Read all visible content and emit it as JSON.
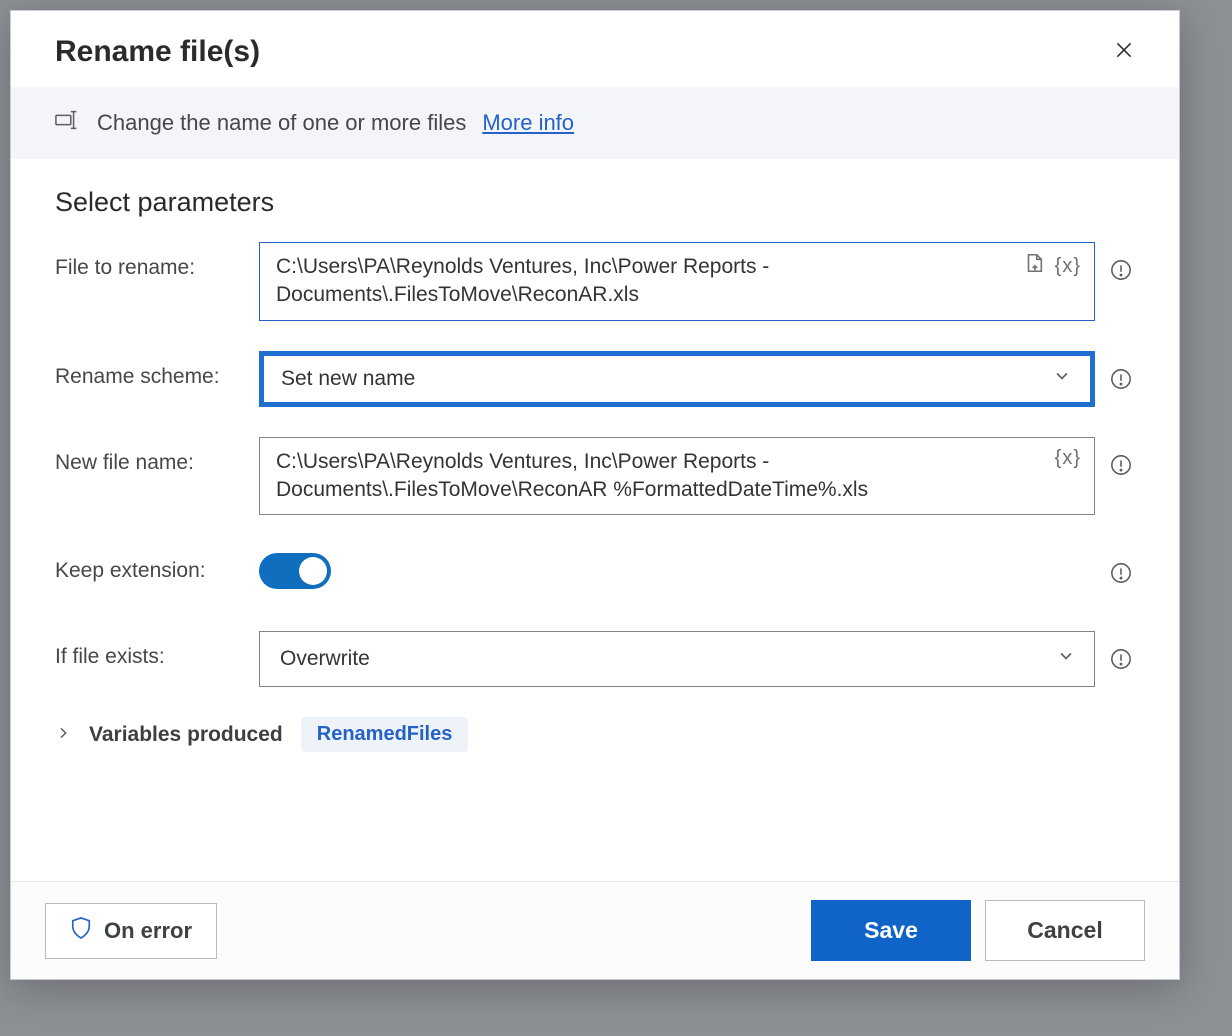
{
  "dialog": {
    "title": "Rename file(s)",
    "info_text": "Change the name of one or more files",
    "more_info_label": "More info",
    "section_heading": "Select parameters"
  },
  "fields": {
    "file_to_rename": {
      "label": "File to rename:",
      "value": "C:\\Users\\PA\\Reynolds Ventures, Inc\\Power Reports - Documents\\.FilesToMove\\ReconAR.xls"
    },
    "rename_scheme": {
      "label": "Rename scheme:",
      "value": "Set new name"
    },
    "new_file_name": {
      "label": "New file name:",
      "value": "C:\\Users\\PA\\Reynolds Ventures, Inc\\Power Reports - Documents\\.FilesToMove\\ReconAR %FormattedDateTime%.xls"
    },
    "keep_extension": {
      "label": "Keep extension:",
      "value": true
    },
    "if_file_exists": {
      "label": "If file exists:",
      "value": "Overwrite"
    }
  },
  "variables_section": {
    "label": "Variables produced",
    "chip": "RenamedFiles"
  },
  "footer": {
    "on_error": "On error",
    "save": "Save",
    "cancel": "Cancel"
  },
  "icons": {
    "var_token": "{x}"
  }
}
